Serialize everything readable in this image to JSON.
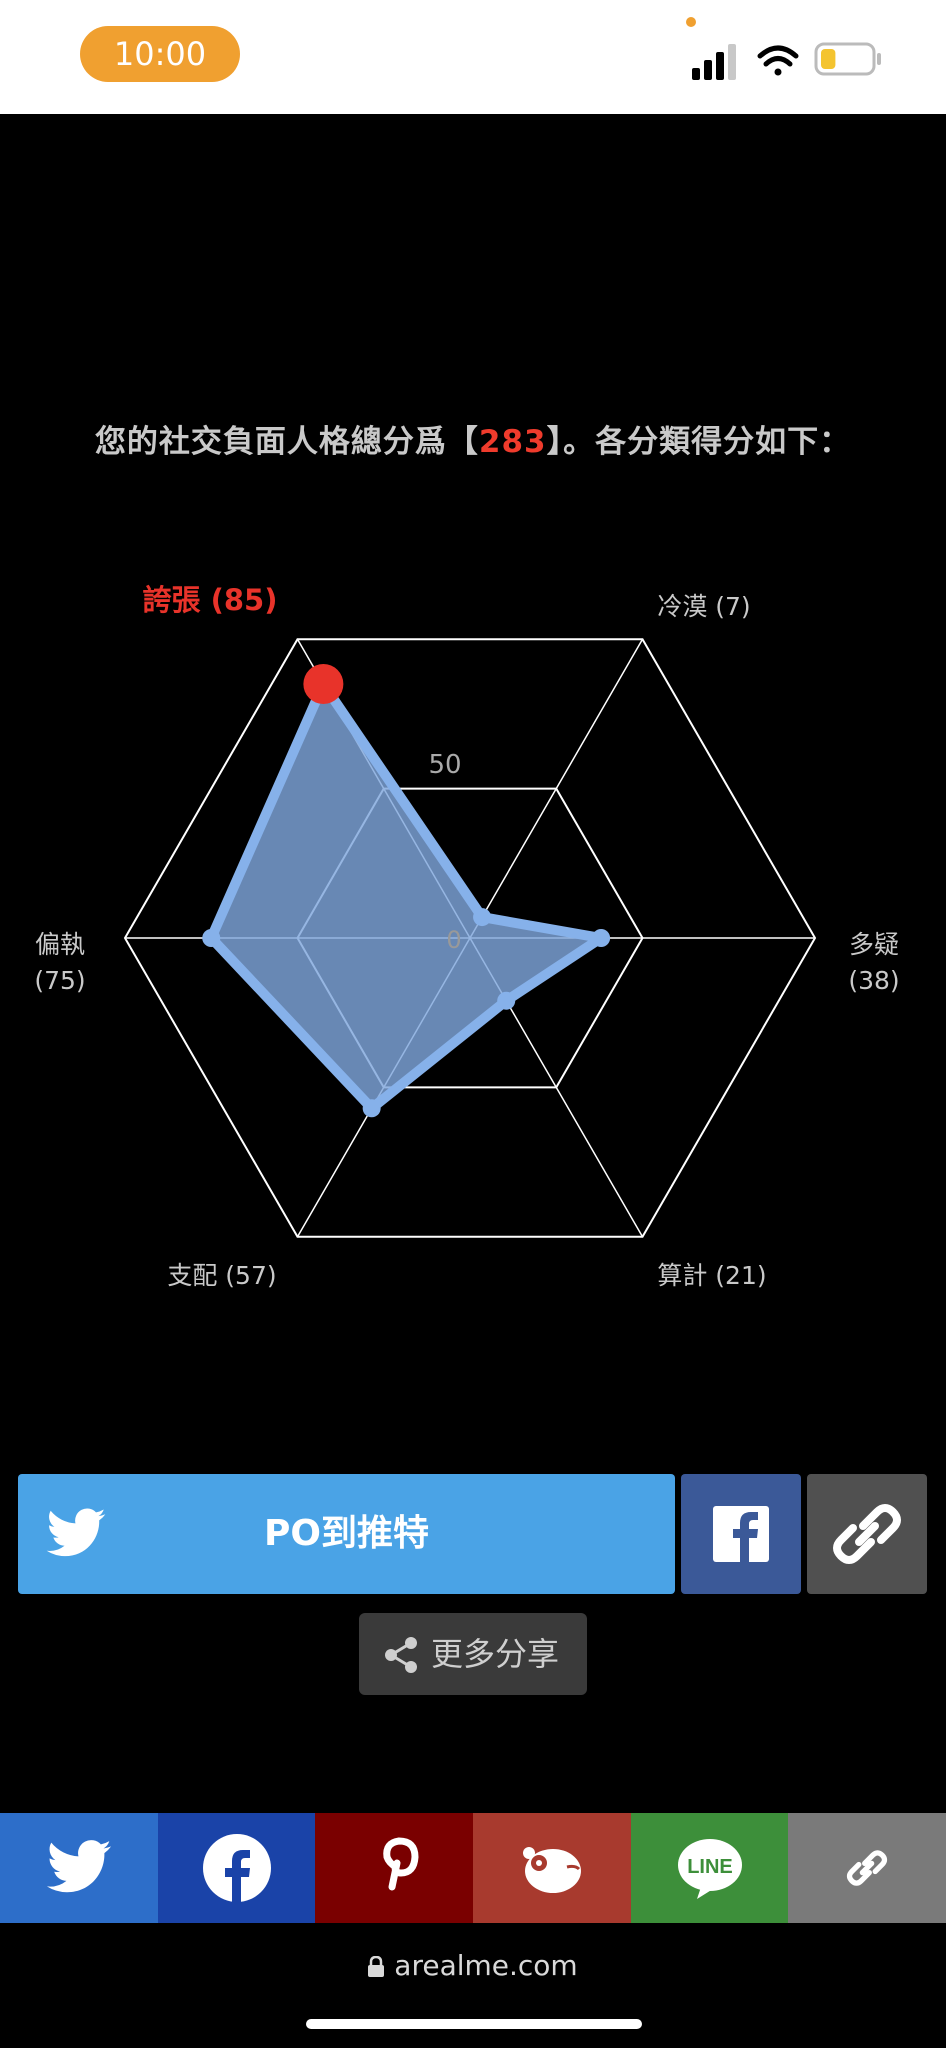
{
  "status_bar": {
    "time": "10:00",
    "battery_level": 0.3
  },
  "headline": {
    "prefix": "您的社交負面人格總分爲【",
    "score": "283",
    "suffix": "】。各分類得分如下："
  },
  "chart_data": {
    "type": "radar",
    "scale_max": 100,
    "scale_label": "50",
    "center_label": "0",
    "axes": [
      {
        "name": "誇張",
        "value": 85,
        "label": "誇張 (85)",
        "highlight": true
      },
      {
        "name": "冷漠",
        "value": 7,
        "label": "冷漠 (7)"
      },
      {
        "name": "多疑",
        "value": 38,
        "label1": "多疑",
        "label2": "(38)"
      },
      {
        "name": "算計",
        "value": 21,
        "label": "算計 (21)"
      },
      {
        "name": "支配",
        "value": 57,
        "label": "支配 (57)"
      },
      {
        "name": "偏執",
        "value": 75,
        "label1": "偏執",
        "label2": "(75)"
      }
    ],
    "colors": {
      "fill": "#7fa6dc",
      "stroke": "#86b1ea",
      "highlight": "#e8332a",
      "grid": "#ffffff"
    }
  },
  "buttons": {
    "twitter_label": "PO到推特",
    "more_share_label": "更多分享",
    "twitter_color": "#4aa3e6",
    "facebook_color": "#3b5998",
    "link_color": "#505050"
  },
  "share_bar": [
    {
      "icon": "twitter-icon",
      "color": "#2d6ec9"
    },
    {
      "icon": "facebook-icon",
      "color": "#1a43a8"
    },
    {
      "icon": "pinterest-icon",
      "color": "#7a0000"
    },
    {
      "icon": "plurk-icon",
      "color": "#a83a2e"
    },
    {
      "icon": "line-icon",
      "color": "#3d8f3a"
    },
    {
      "icon": "link-icon",
      "color": "#7a7a7a"
    }
  ],
  "browser": {
    "url": "arealme.com"
  }
}
